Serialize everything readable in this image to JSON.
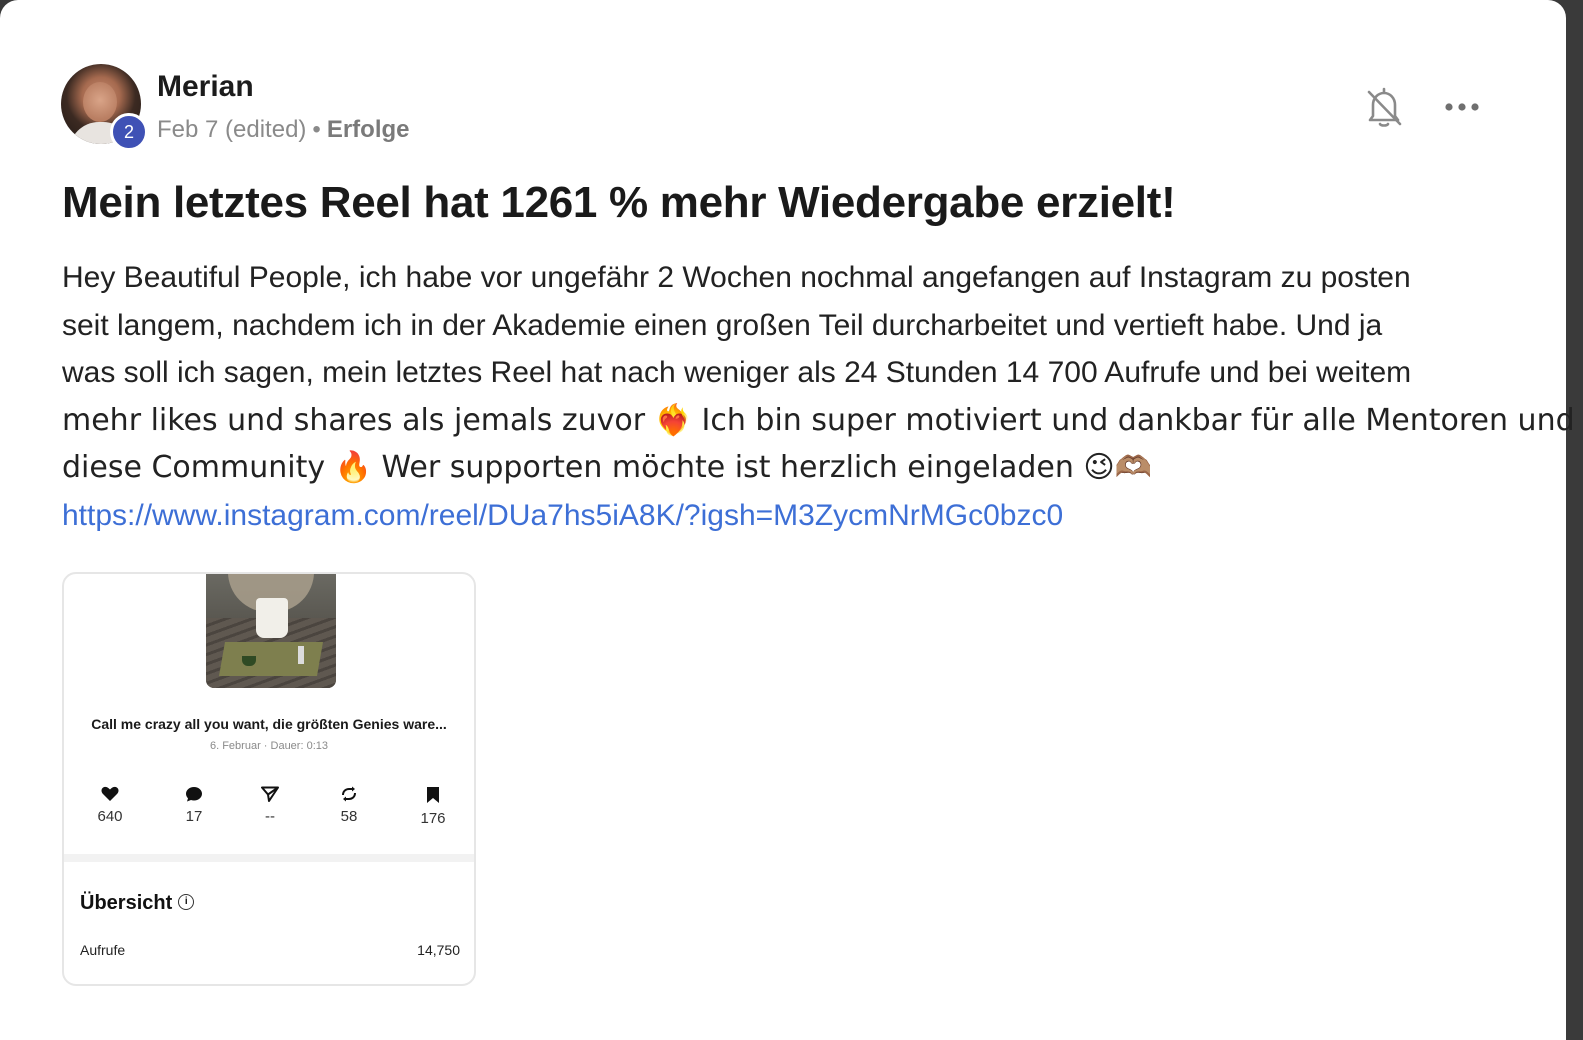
{
  "post": {
    "author": {
      "name": "Merian",
      "level": "2"
    },
    "meta": {
      "date": "Feb 7 (edited)",
      "separator": "•",
      "category": "Erfolge"
    },
    "title": "Mein letztes Reel hat 1261 % mehr Wiedergabe erzielt!",
    "body_lines": [
      "Hey Beautiful People, ich habe vor ungefähr 2 Wochen nochmal angefangen auf Instagram zu posten",
      "seit langem, nachdem ich in der Akademie einen großen Teil durcharbeitet und vertieft habe. Und ja",
      "was soll ich sagen, mein letztes Reel hat nach weniger als 24 Stunden 14 700 Aufrufe und bei weitem",
      "mehr likes und shares als jemals zuvor ❤️‍🔥 Ich bin super motiviert und dankbar für alle Mentoren und",
      "diese Community 🔥 Wer supporten möchte ist herzlich eingeladen 😉🫶🏽"
    ],
    "link": "https://www.instagram.com/reel/DUa7hs5iA8K/?igsh=M3ZycmNrMGc0bzc0",
    "icons": {
      "bell": "bell-off-icon",
      "more": "more-horizontal-icon"
    }
  },
  "attachment": {
    "reel_caption": "Call me crazy all you want, die größten Genies ware...",
    "reel_date": "6. Februar · Dauer: 0:13",
    "stats": {
      "likes": "640",
      "comments": "17",
      "shares": "--",
      "reposts": "58",
      "saves": "176"
    },
    "overview": {
      "title": "Übersicht",
      "info_glyph": "i",
      "rows": [
        {
          "label": "Aufrufe",
          "value": "14,750"
        }
      ]
    }
  }
}
